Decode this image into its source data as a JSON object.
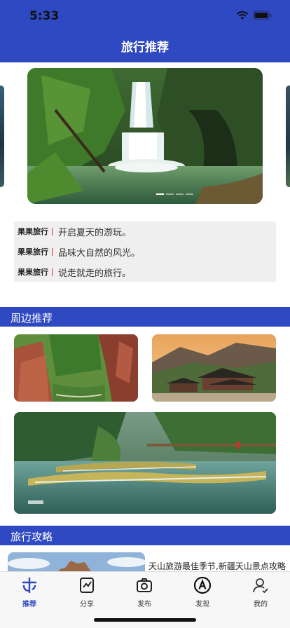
{
  "status_bar": {
    "time": "5:33"
  },
  "nav": {
    "title": "旅行推荐"
  },
  "carousel": {
    "page_count": 4,
    "active_index": 0
  },
  "notices": [
    {
      "tag": "果果旅行",
      "text": "开启夏天的游玩。"
    },
    {
      "tag": "果果旅行",
      "text": "品味大自然的风光。"
    },
    {
      "tag": "果果旅行",
      "text": "说走就走的旅行。"
    }
  ],
  "nearby": {
    "title": "周边推荐"
  },
  "guide": {
    "title": "旅行攻略",
    "article_title": "天山旅游最佳季节,新疆天山景点攻略"
  },
  "tabs": [
    {
      "label": "推荐",
      "icon": "recommend-icon",
      "active": true
    },
    {
      "label": "分享",
      "icon": "share-note-icon",
      "active": false
    },
    {
      "label": "发布",
      "icon": "camera-icon",
      "active": false
    },
    {
      "label": "发现",
      "icon": "discover-icon",
      "active": false
    },
    {
      "label": "我的",
      "icon": "profile-icon",
      "active": false
    }
  ],
  "colors": {
    "primary": "#2f49c2",
    "notice_bg": "#efefef",
    "tabbar_bg": "#f7f7f7"
  }
}
